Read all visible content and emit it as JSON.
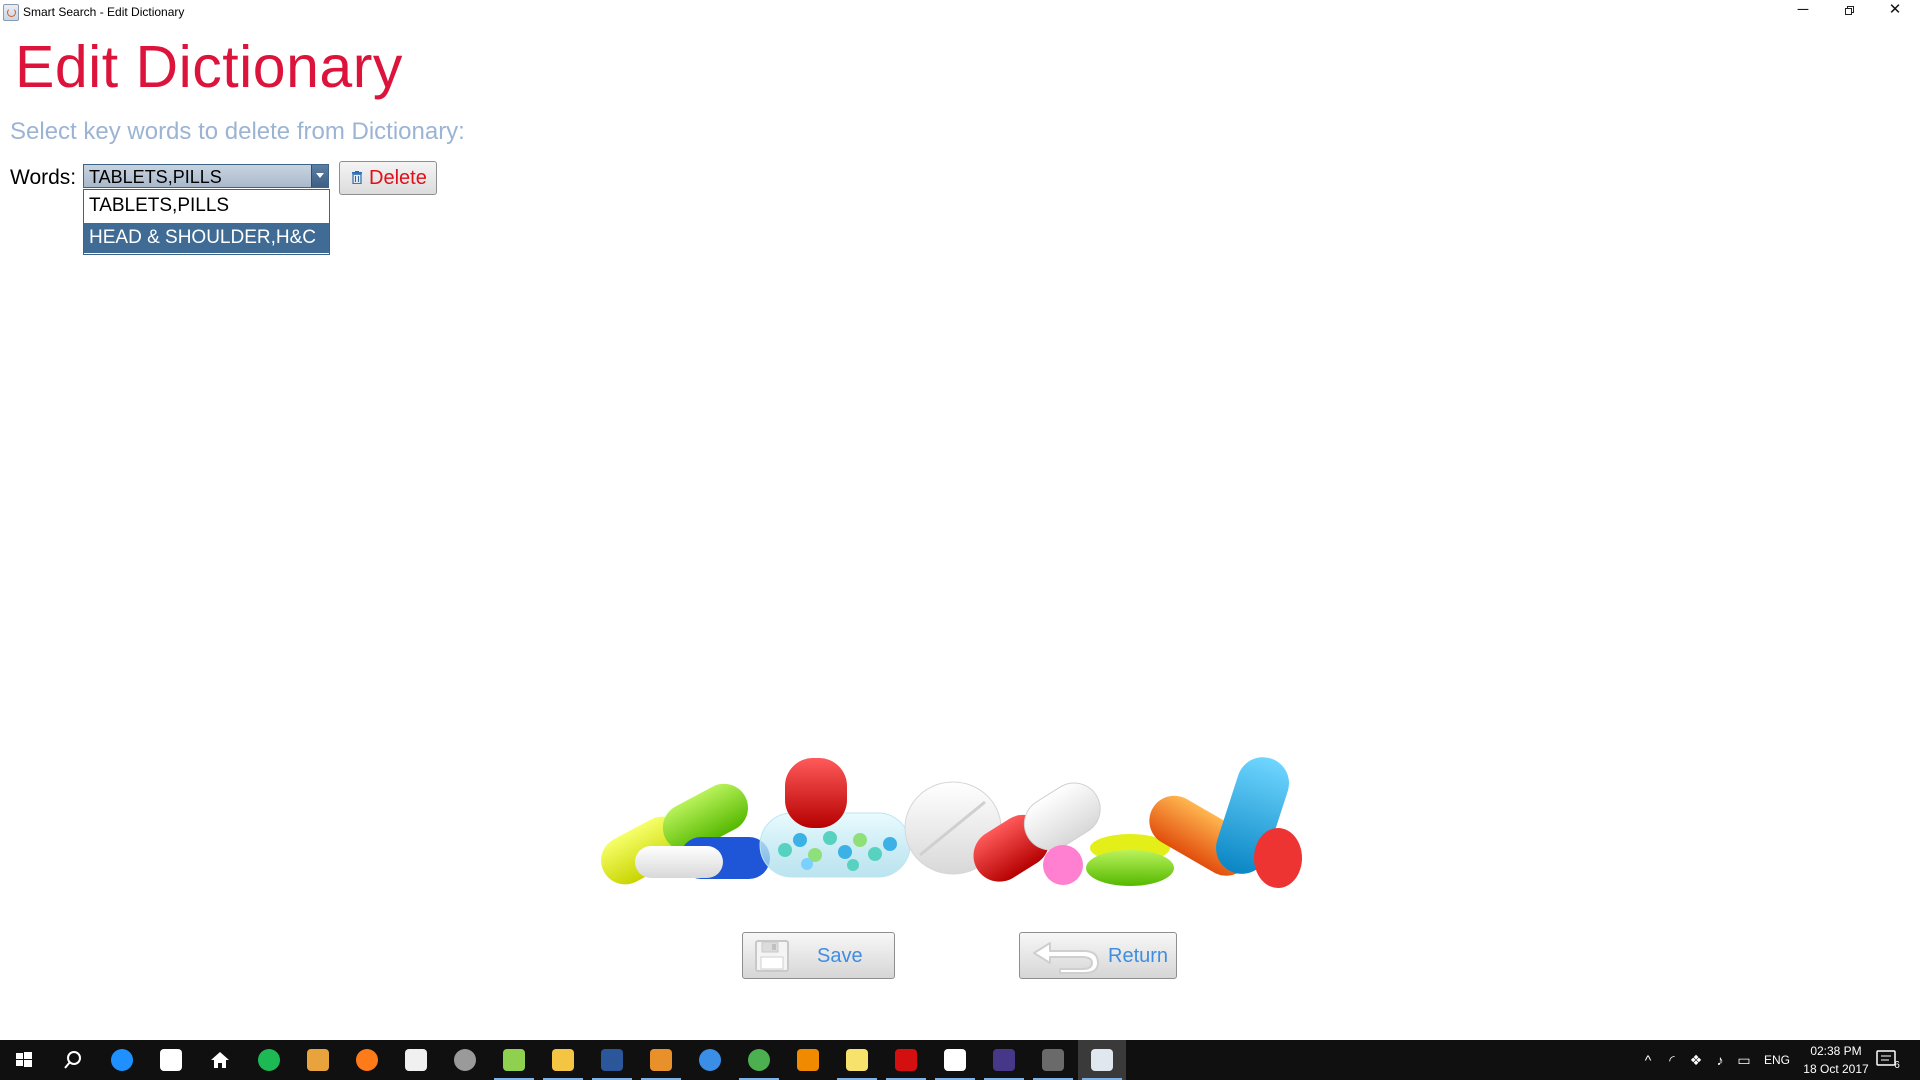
{
  "window": {
    "title": "Smart Search - Edit Dictionary",
    "controls": {
      "minimize": "─",
      "close": "✕"
    }
  },
  "page": {
    "title": "Edit Dictionary",
    "instruction": "Select key words to delete from Dictionary:"
  },
  "words": {
    "label": "Words:",
    "selected": "TABLETS,PILLS",
    "options": [
      "TABLETS,PILLS",
      "HEAD & SHOULDER,H&C"
    ],
    "highlighted_index": 1
  },
  "buttons": {
    "delete": "Delete",
    "save": "Save",
    "return": "Return"
  },
  "taskbar": {
    "items": [
      {
        "name": "start",
        "icon": "windows-logo-icon",
        "color": "#ffffff"
      },
      {
        "name": "search",
        "icon": "search-icon",
        "color": "#ffffff"
      },
      {
        "name": "edge",
        "icon": "edge-icon",
        "color": "#1e90ff"
      },
      {
        "name": "store",
        "icon": "store-icon",
        "color": "#ffffff"
      },
      {
        "name": "home",
        "icon": "home-icon",
        "color": "#ffffff"
      },
      {
        "name": "spotify",
        "icon": "spotify-icon",
        "color": "#1db954"
      },
      {
        "name": "app-orange",
        "icon": "package-icon",
        "color": "#e8a33c"
      },
      {
        "name": "firefox",
        "icon": "firefox-icon",
        "color": "#ff7a18"
      },
      {
        "name": "app-doc",
        "icon": "document-icon",
        "color": "#f0f0f0"
      },
      {
        "name": "app-globe",
        "icon": "globe-icon",
        "color": "#9a9a9a"
      },
      {
        "name": "notepad",
        "icon": "notepad-icon",
        "color": "#8fd14f"
      },
      {
        "name": "explorer",
        "icon": "folder-icon",
        "color": "#f4c542"
      },
      {
        "name": "word",
        "icon": "word-icon",
        "color": "#2b579a"
      },
      {
        "name": "media",
        "icon": "media-player-icon",
        "color": "#e8902a"
      },
      {
        "name": "feedback",
        "icon": "feedback-icon",
        "color": "#3a8ee6"
      },
      {
        "name": "chrome",
        "icon": "chrome-icon",
        "color": "#4caf50"
      },
      {
        "name": "vlc",
        "icon": "vlc-icon",
        "color": "#f08a00"
      },
      {
        "name": "sticky-notes",
        "icon": "sticky-note-icon",
        "color": "#f7e36b"
      },
      {
        "name": "acrobat",
        "icon": "acrobat-icon",
        "color": "#d40f0f"
      },
      {
        "name": "slack",
        "icon": "slack-icon",
        "color": "#ffffff"
      },
      {
        "name": "eclipse",
        "icon": "eclipse-icon",
        "color": "#473788"
      },
      {
        "name": "terminal",
        "icon": "terminal-icon",
        "color": "#6a6a6a"
      },
      {
        "name": "java",
        "icon": "java-icon",
        "color": "#e0e7ef"
      }
    ],
    "language": "ENG",
    "time": "02:38 PM",
    "date": "18 Oct 2017",
    "notification_count": "6"
  }
}
